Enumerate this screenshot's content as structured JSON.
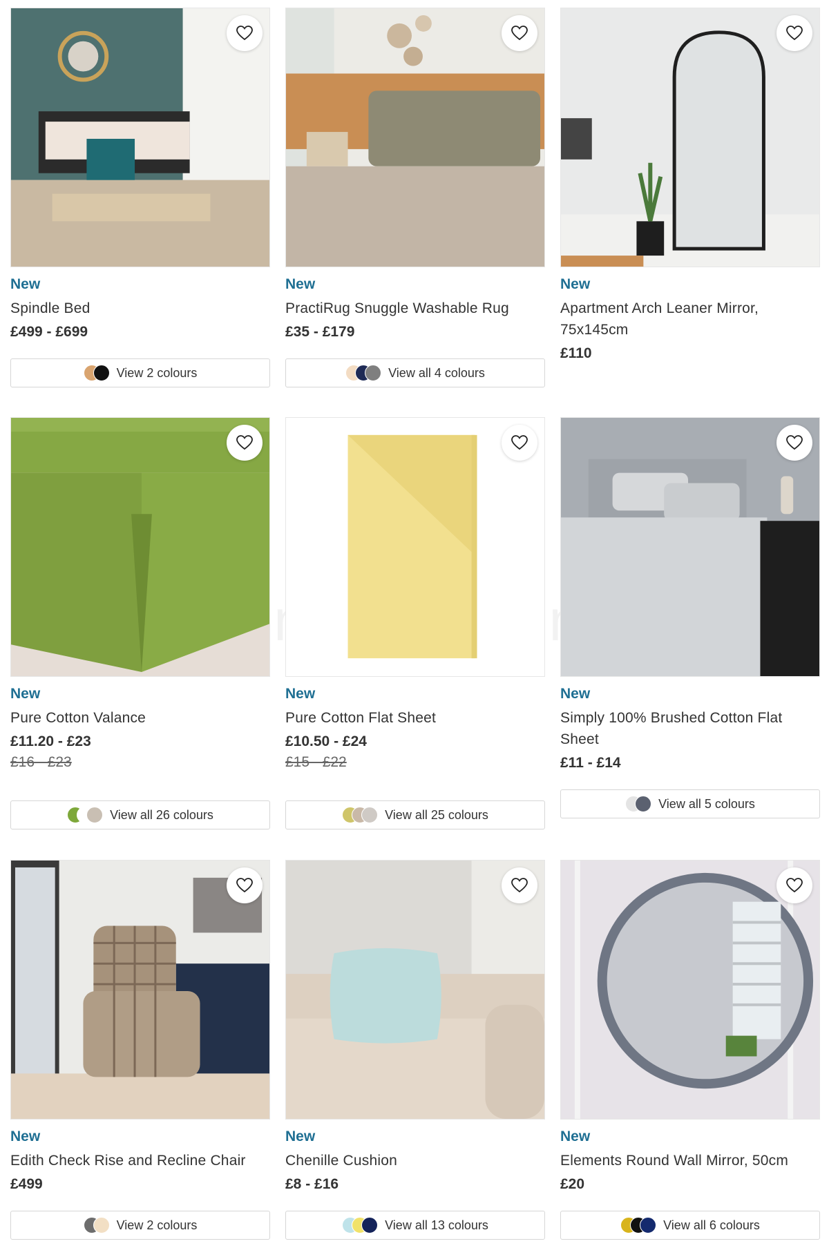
{
  "products": [
    {
      "badge": "New",
      "title": "Spindle Bed",
      "price": "£499 - £699",
      "was": "",
      "colours_label": "View 2 colours",
      "swatches": [
        "#d9a46f",
        "#111111"
      ],
      "icon": "heart-icon"
    },
    {
      "badge": "New",
      "title": "PractiRug Snuggle Washable Rug",
      "price": "£35 - £179",
      "was": "",
      "colours_label": "View all 4 colours",
      "swatches": [
        "#f3dcc3",
        "#1e2a55",
        "#7f7f7f"
      ],
      "icon": "heart-icon"
    },
    {
      "badge": "New",
      "title": "Apartment Arch Leaner Mirror, 75x145cm",
      "price": "£110",
      "was": "",
      "colours_label": "",
      "swatches": [],
      "icon": "heart-icon"
    },
    {
      "badge": "New",
      "title": "Pure Cotton Valance",
      "price": "£11.20 - £23",
      "was": "£16 - £23",
      "colours_label": "View all 26 colours",
      "swatches": [
        "#7ea83a",
        "#ffffff",
        "#c9bfb3"
      ],
      "icon": "heart-icon"
    },
    {
      "badge": "New",
      "title": "Pure Cotton Flat Sheet",
      "price": "£10.50 - £24",
      "was": "£15 - £22",
      "colours_label": "View all 25 colours",
      "swatches": [
        "#cfc56a",
        "#c9b9a8",
        "#cfcac5"
      ],
      "icon": "heart-icon"
    },
    {
      "badge": "New",
      "title": "Simply 100% Brushed Cotton Flat Sheet",
      "price": "£11 - £14",
      "was": "",
      "colours_label": "View all 5 colours",
      "swatches": [
        "#e4e4e4",
        "#5b6170"
      ],
      "icon": "heart-icon"
    },
    {
      "badge": "New",
      "title": "Edith Check Rise and Recline Chair",
      "price": "£499",
      "was": "",
      "colours_label": "View 2 colours",
      "swatches": [
        "#6d6d6d",
        "#f2dfc4"
      ],
      "icon": "heart-icon"
    },
    {
      "badge": "New",
      "title": "Chenille Cushion",
      "price": "£8 - £16",
      "was": "",
      "colours_label": "View all 13 colours",
      "swatches": [
        "#bfe3ea",
        "#f1e26a",
        "#14235a"
      ],
      "icon": "heart-icon"
    },
    {
      "badge": "New",
      "title": "Elements Round Wall Mirror, 50cm",
      "price": "£20",
      "was": "",
      "colours_label": "View all 6 colours",
      "swatches": [
        "#d8b41c",
        "#111111",
        "#142a6e"
      ],
      "icon": "heart-icon"
    }
  ],
  "watermark": "openingtimesin.uk",
  "colors": {
    "badge": "#1f6f93",
    "text": "#333333"
  }
}
